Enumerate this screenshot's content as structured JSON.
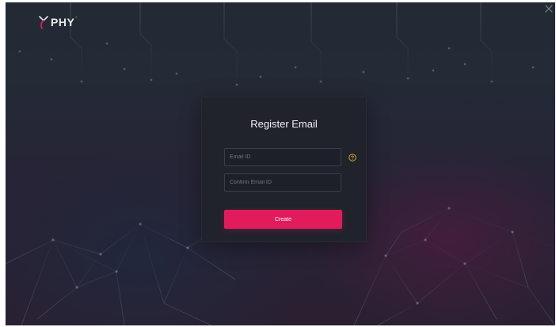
{
  "app": {
    "logo_text": "PHY",
    "logo_mark": "°"
  },
  "window": {
    "close_icon": "close-icon"
  },
  "register": {
    "title": "Register Email",
    "email_placeholder": "Email ID",
    "confirm_placeholder": "Confirm Email ID",
    "email_value": "",
    "confirm_value": "",
    "help_icon": "help-circle-icon",
    "create_label": "Create"
  },
  "colors": {
    "accent": "#e21c5c",
    "help_icon": "#d4a21c",
    "logo_accent": "#e21c5c",
    "background_top": "#232a34",
    "background_bottom": "#2a2032",
    "card_background": "#20232c"
  }
}
